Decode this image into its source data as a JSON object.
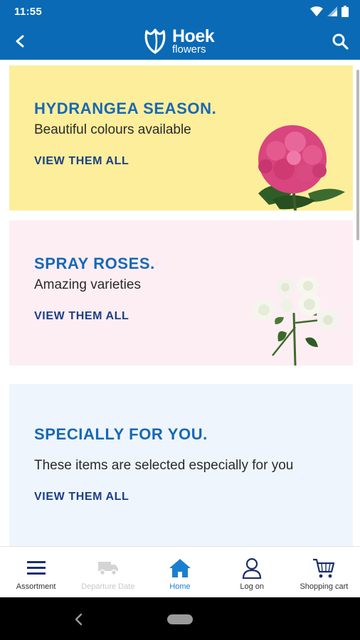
{
  "status_bar": {
    "time": "11:55"
  },
  "app_bar": {
    "logo_brand": "Hoek",
    "logo_sub": "flowers"
  },
  "banners": [
    {
      "title": "HYDRANGEA SEASON.",
      "subtitle": "Beautiful colours available",
      "link": "VIEW THEM ALL",
      "bg_color": "#fdee9b",
      "image": "pink-hydrangea"
    },
    {
      "title": "SPRAY ROSES.",
      "subtitle": "Amazing varieties",
      "link": "VIEW THEM ALL",
      "bg_color": "#fdeef3",
      "image": "white-spray-roses"
    },
    {
      "title": "SPECIALLY FOR YOU.",
      "subtitle": "These items are selected especially for you",
      "link": "VIEW THEM ALL",
      "bg_color": "#eef5fc"
    }
  ],
  "bottom_nav": {
    "items": [
      {
        "label": "Assortment",
        "icon": "menu-icon",
        "state": "normal"
      },
      {
        "label": "Departure Date",
        "icon": "truck-icon",
        "state": "disabled"
      },
      {
        "label": "Home",
        "icon": "home-icon",
        "state": "active"
      },
      {
        "label": "Log on",
        "icon": "user-icon",
        "state": "normal"
      },
      {
        "label": "Shopping cart",
        "icon": "cart-icon",
        "state": "normal"
      }
    ]
  },
  "colors": {
    "brand_blue": "#0a6ab5",
    "title_blue": "#1768b5",
    "link_navy": "#1b3f86",
    "active_nav": "#1a7fd0"
  }
}
